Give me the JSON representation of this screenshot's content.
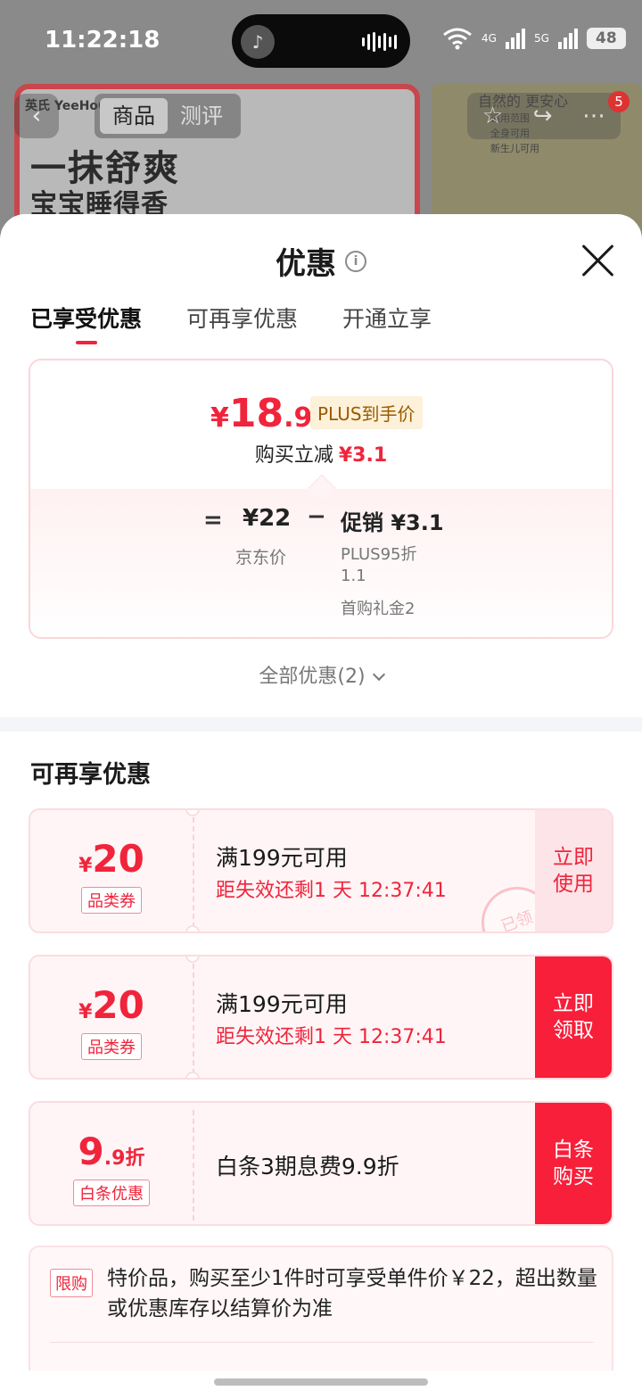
{
  "status_bar": {
    "time": "11:22:18",
    "network_1": "4G",
    "network_2": "5G",
    "battery": "48"
  },
  "background_page": {
    "brand": "英氏 YeeHoO",
    "nav_tabs": [
      "商品",
      "测评"
    ],
    "headline_1": "一抹舒爽",
    "headline_2": "宝宝睡得香",
    "side_text": "自然的 更安心",
    "badges": [
      "适用范围",
      "全身可用",
      "新生儿可用"
    ],
    "message_count": "5"
  },
  "sheet": {
    "title": "优惠",
    "tabs": [
      "已享受优惠",
      "可再享优惠",
      "开通立享"
    ],
    "price_card": {
      "final_currency": "¥",
      "final_int": "18",
      "final_dec": ".9",
      "plus_tag": "PLUS到手价",
      "reduce_label": "购买立减",
      "reduce_amount": "¥3.1",
      "equals": "=",
      "jd_price": "¥22",
      "jd_label": "京东价",
      "minus": "−",
      "promo": "促销 ¥3.1",
      "promo_detail_1": "PLUS95折 1.1",
      "promo_detail_2": "首购礼金2"
    },
    "all_promos": "全部优惠(2)",
    "section_title": "可再享优惠",
    "coupons": [
      {
        "yen": "¥",
        "amount": "20",
        "type": "品类券",
        "condition": "满199元可用",
        "expire": "距失效还剩1 天 12:37:41",
        "button": "立即使用",
        "stamp": "已领"
      },
      {
        "yen": "¥",
        "amount": "20",
        "type": "品类券",
        "condition": "满199元可用",
        "expire": "距失效还剩1 天 12:37:41",
        "button": "立即领取"
      },
      {
        "amount": "9",
        "suffix": ".9折",
        "type": "白条优惠",
        "condition": "白条3期息费9.9折",
        "button": "白条购买"
      }
    ],
    "limit": {
      "tag": "限购",
      "text": "特价品，购买至少1件时可享受单件价￥22，超出数量或优惠库存以结算价为准"
    }
  },
  "colors": {
    "accent": "#f0243b",
    "button_solid": "#f71f3a",
    "button_light": "#fde4e8",
    "plus_tag_bg": "#fdf1d9"
  }
}
